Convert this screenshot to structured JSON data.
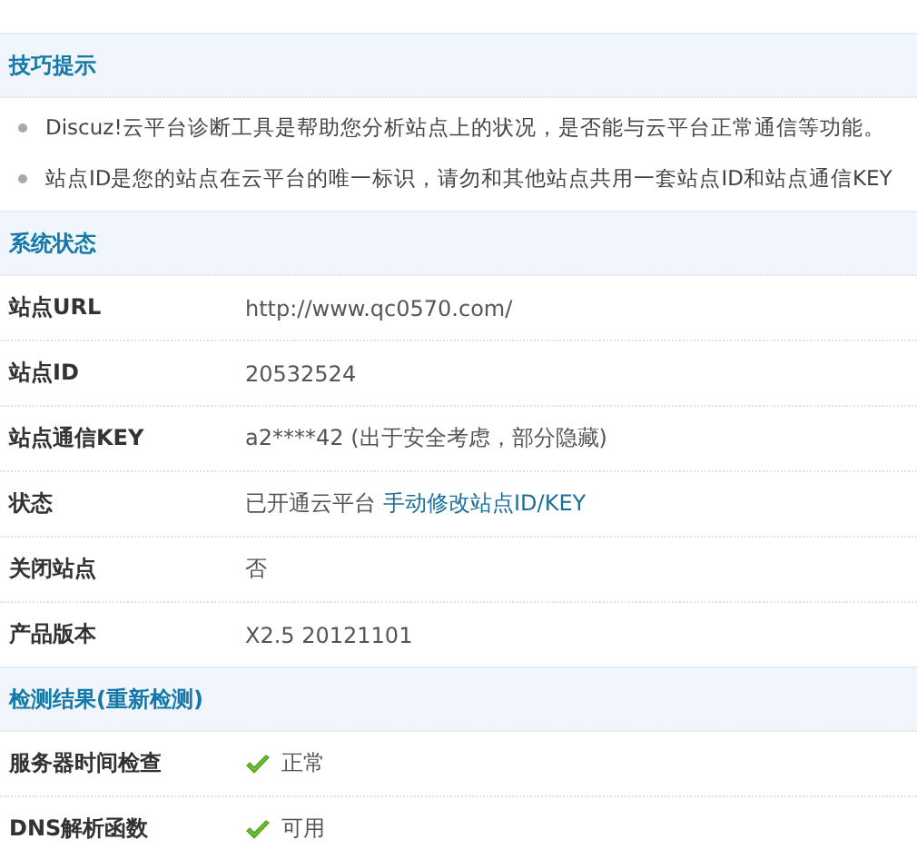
{
  "sections": [
    {
      "kind": "tips",
      "title": "技巧提示",
      "items": [
        "Discuz!云平台诊断工具是帮助您分析站点上的状况，是否能与云平台正常通信等功能。",
        "站点ID是您的站点在云平台的唯一标识，请勿和其他站点共用一套站点ID和站点通信KEY"
      ]
    },
    {
      "kind": "table",
      "title": "系统状态",
      "rows": [
        {
          "label": "站点URL",
          "value": "http://www.qc0570.com/"
        },
        {
          "label": "站点ID",
          "value": "20532524"
        },
        {
          "label": "站点通信KEY",
          "value": "a2****42 (出于安全考虑，部分隐藏)"
        },
        {
          "label": "状态",
          "value": "已开通云平台",
          "link": "手动修改站点ID/KEY"
        },
        {
          "label": "关闭站点",
          "value": "否"
        },
        {
          "label": "产品版本",
          "value": "X2.5 20121101"
        }
      ]
    },
    {
      "kind": "table",
      "title": "检测结果(重新检测)",
      "rows": [
        {
          "label": "服务器时间检查",
          "value": "正常",
          "check": true
        },
        {
          "label": "DNS解析函数",
          "value": "可用",
          "check": true
        }
      ]
    }
  ]
}
